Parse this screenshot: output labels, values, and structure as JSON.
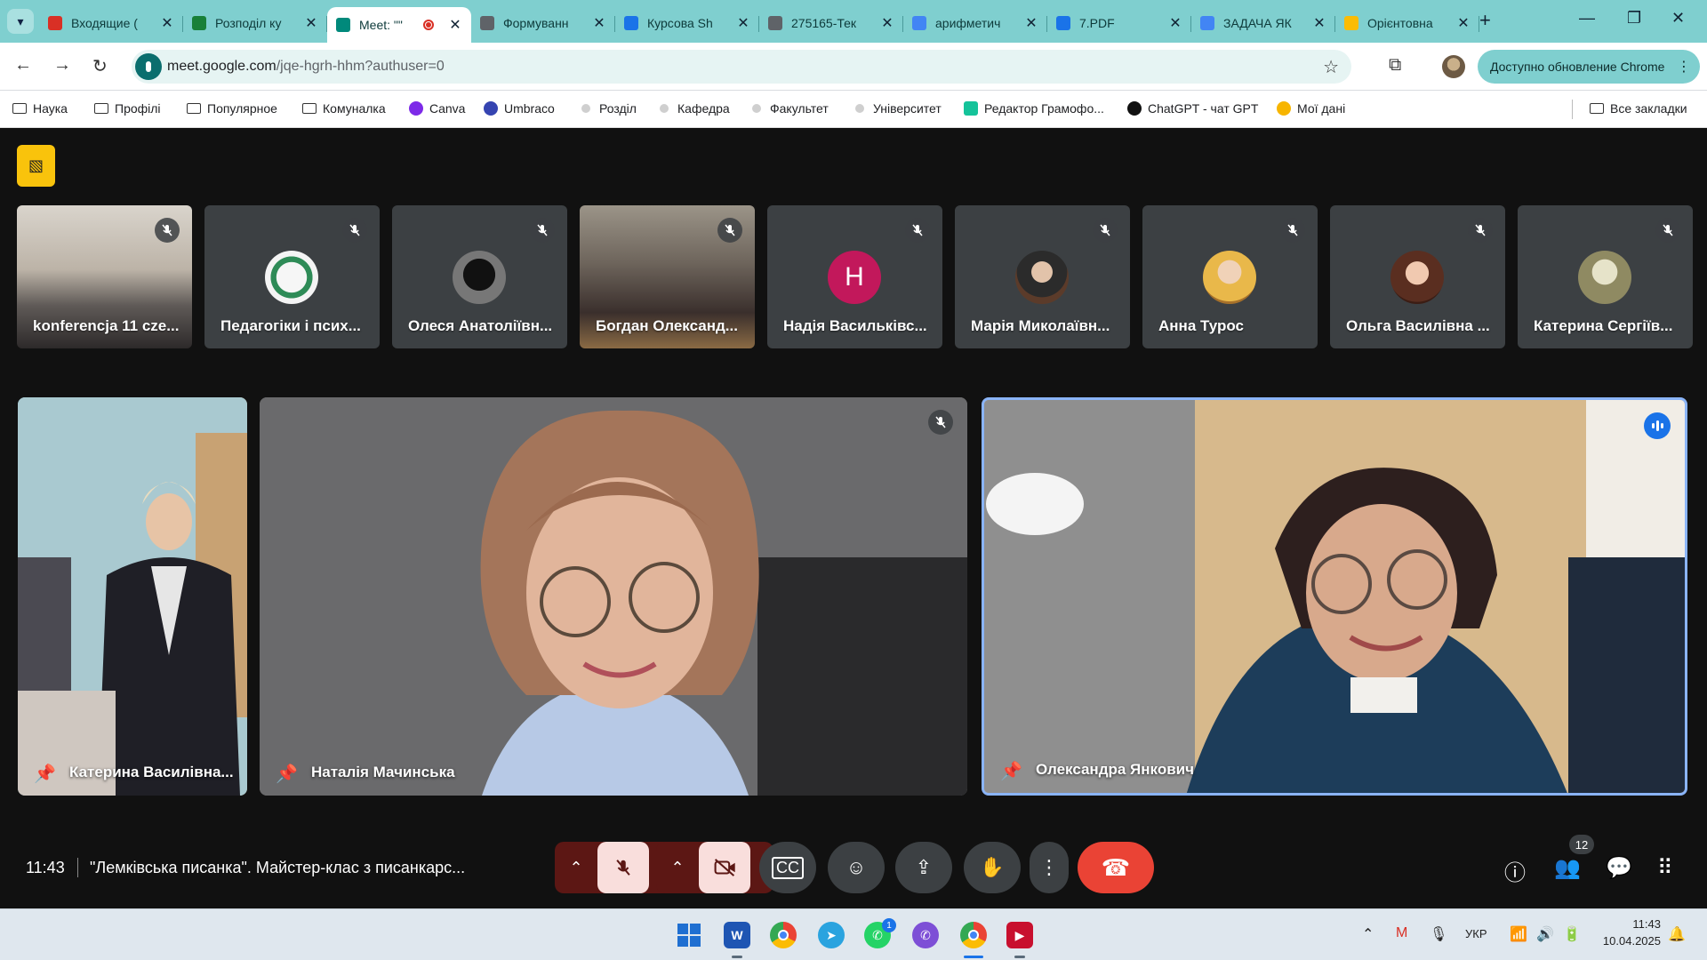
{
  "browser": {
    "tabs": [
      {
        "title": "Входящие (",
        "favicon": "gmail-icon",
        "color": "#d93025",
        "active": false
      },
      {
        "title": "Розподіл ку",
        "favicon": "sheets-icon",
        "color": "#188038",
        "active": false
      },
      {
        "title": "Meet: \"\"",
        "favicon": "meet-icon",
        "color": "#00897b",
        "active": true,
        "recording": true
      },
      {
        "title": "Формуванн",
        "favicon": "globe-icon",
        "color": "#5f6368",
        "active": false
      },
      {
        "title": "Курсова Sh",
        "favicon": "flag-icon",
        "color": "#1a73e8",
        "active": false
      },
      {
        "title": "275165-Тек",
        "favicon": "globe-icon",
        "color": "#5f6368",
        "active": false
      },
      {
        "title": "арифметич",
        "favicon": "google-icon",
        "color": "#4285f4",
        "active": false
      },
      {
        "title": "7.PDF",
        "favicon": "file-icon",
        "color": "#1a73e8",
        "active": false
      },
      {
        "title": "ЗАДАЧА ЯК",
        "favicon": "google-icon",
        "color": "#4285f4",
        "active": false
      },
      {
        "title": "Орієнтовна",
        "favicon": "drive-icon",
        "color": "#fbbc04",
        "active": false
      }
    ],
    "url_host": "meet.google.com",
    "url_path": "/jqe-hgrh-hhm?authuser=0",
    "update_label": "Доступно обновление Chrome",
    "bookmarks": [
      {
        "label": "Наука",
        "icon": "folder-icon"
      },
      {
        "label": "Профілі",
        "icon": "folder-icon"
      },
      {
        "label": "Популярное",
        "icon": "folder-icon"
      },
      {
        "label": "Комуналка",
        "icon": "folder-icon"
      },
      {
        "label": "Canva",
        "icon": "canva-icon"
      },
      {
        "label": "Umbraco",
        "icon": "umbraco-icon"
      },
      {
        "label": "Розділ",
        "icon": "dot-icon"
      },
      {
        "label": "Кафедра",
        "icon": "dot-icon"
      },
      {
        "label": "Факультет",
        "icon": "dot-icon"
      },
      {
        "label": "Університет",
        "icon": "dot-icon"
      },
      {
        "label": "Редактор Грамофо...",
        "icon": "grammar-icon"
      },
      {
        "label": "ChatGPT - чат GPT",
        "icon": "chatgpt-icon"
      },
      {
        "label": "Мої дані",
        "icon": "balloon-icon"
      }
    ],
    "all_bookmarks_label": "Все закладки"
  },
  "meet": {
    "thumbnails": [
      {
        "name": "konferencja 11 cze...",
        "kind": "video",
        "muted": true
      },
      {
        "name": "Педагогіки і псих...",
        "kind": "avatar",
        "muted": true
      },
      {
        "name": "Олеся Анатоліївн...",
        "kind": "avatar",
        "muted": true
      },
      {
        "name": "Богдан Олександ...",
        "kind": "video",
        "muted": true
      },
      {
        "name": "Надія Васильківс...",
        "kind": "letter",
        "letter": "Н",
        "muted": true
      },
      {
        "name": "Марія Миколаївн...",
        "kind": "avatar",
        "muted": true
      },
      {
        "name": "Анна Турос",
        "kind": "avatar",
        "muted": true
      },
      {
        "name": "Ольга Василівна ...",
        "kind": "avatar",
        "muted": true
      },
      {
        "name": "Катерина Сергіїв...",
        "kind": "avatar",
        "muted": true
      }
    ],
    "tiles": [
      {
        "name": "Катерина Василівна..."
      },
      {
        "name": "Наталія Мачинська"
      },
      {
        "name": "Олександра Янкович"
      }
    ],
    "time": "11:43",
    "meeting_title": "\"Лемківська писанка\". Майстер-клас з писанкарс...",
    "people_count": "12",
    "colors": {
      "accent": "#1a73e8",
      "danger": "#ea4335",
      "surface": "#3c4043",
      "camoff": "#f9c30c"
    }
  },
  "taskbar": {
    "lang": "УКР",
    "time": "11:43",
    "date": "10.04.2025",
    "telegram_badge": "1"
  }
}
